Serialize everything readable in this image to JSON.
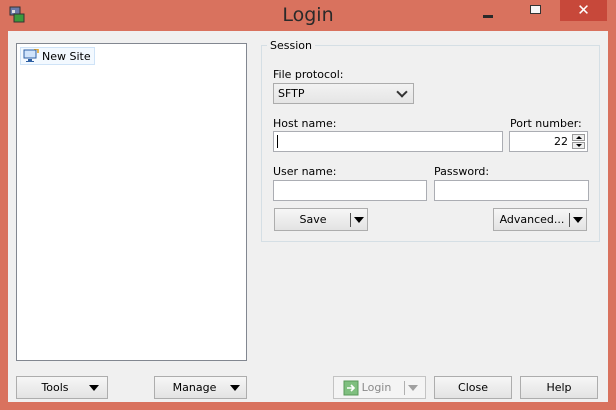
{
  "window": {
    "title": "Login",
    "close_glyph": "✕"
  },
  "site_tree": {
    "items": [
      {
        "label": "New Site",
        "icon": "monitor-icon"
      }
    ]
  },
  "session": {
    "group_label": "Session",
    "file_protocol": {
      "label": "File protocol:",
      "value": "SFTP"
    },
    "host_name": {
      "label": "Host name:",
      "value": ""
    },
    "port_number": {
      "label": "Port number:",
      "value": "22"
    },
    "user_name": {
      "label": "User name:",
      "value": ""
    },
    "password": {
      "label": "Password:",
      "value": ""
    },
    "save_label": "Save",
    "advanced_label": "Advanced..."
  },
  "footer": {
    "tools_label": "Tools",
    "manage_label": "Manage",
    "login_label": "Login",
    "close_label": "Close",
    "help_label": "Help"
  },
  "colors": {
    "titlebar": "#d9725e",
    "close_button": "#c7483a",
    "client_bg": "#f0f0f0"
  }
}
